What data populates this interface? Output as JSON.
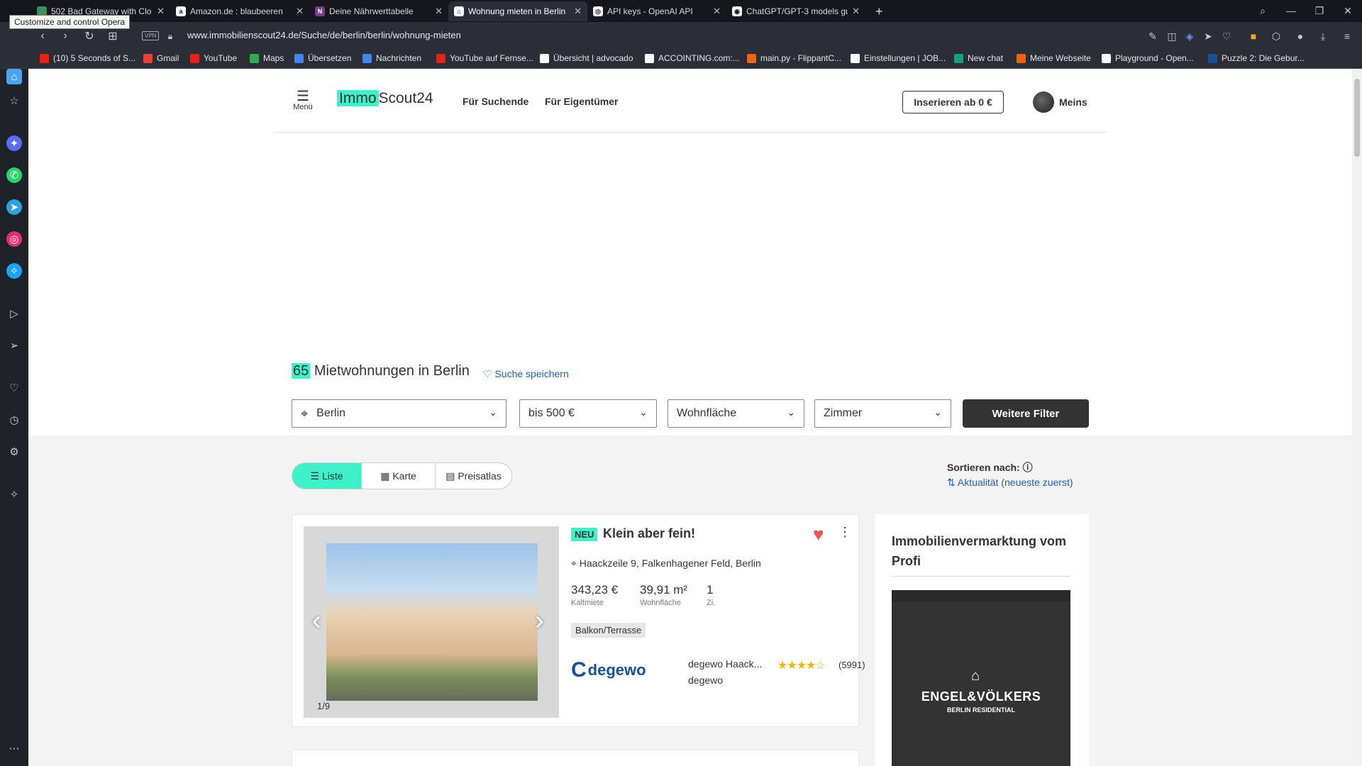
{
  "browser": {
    "tooltip": "Customize and control Opera",
    "tabs": [
      {
        "title": "502 Bad Gateway with Clo",
        "favicon_color": "#3a8f5a"
      },
      {
        "title": "Amazon.de : blaubeeren",
        "favicon_color": "#ffffff"
      },
      {
        "title": "Deine Nährwerttabelle",
        "favicon_color": "#7a3b8f"
      },
      {
        "title": "Wohnung mieten in Berlin",
        "favicon_color": "#ffffff"
      },
      {
        "title": "API keys - OpenAI API",
        "favicon_color": "#ffffff"
      },
      {
        "title": "ChatGPT/GPT-3 models gu",
        "favicon_color": "#ffffff"
      }
    ],
    "close_glyph": "✕",
    "new_tab_glyph": "+",
    "url": "www.immobilienscout24.de/Suche/de/berlin/berlin/wohnung-mieten",
    "vpn_label": "VPN",
    "bookmarks": [
      {
        "label": "(10) 5 Seconds of S...",
        "color": "#e62117"
      },
      {
        "label": "Gmail",
        "color": "#ea4335"
      },
      {
        "label": "YouTube",
        "color": "#e62117"
      },
      {
        "label": "Maps",
        "color": "#34a853"
      },
      {
        "label": "Übersetzen",
        "color": "#4285f4"
      },
      {
        "label": "Nachrichten",
        "color": "#4285f4"
      },
      {
        "label": "YouTube auf Fernse...",
        "color": "#e62117"
      },
      {
        "label": "Übersicht | advocado",
        "color": "#ffffff"
      },
      {
        "label": "ACCOINTING.com:...",
        "color": "#ffffff"
      },
      {
        "label": "main.py - FlippantC...",
        "color": "#f26207"
      },
      {
        "label": "Einstellungen | JOB...",
        "color": "#ffffff"
      },
      {
        "label": "New chat",
        "color": "#10a37f"
      },
      {
        "label": "Meine Webseite",
        "color": "#f26207"
      },
      {
        "label": "Playground - Open...",
        "color": "#ffffff"
      },
      {
        "label": "Puzzle 2: Die Gebur...",
        "color": "#1a4f9c"
      }
    ]
  },
  "header": {
    "menu_label": "Menü",
    "logo_part1": "Immo",
    "logo_part2": "Scout24",
    "nav": [
      "Für Suchende",
      "Für Eigentümer"
    ],
    "insert_button": "Inserieren ab 0 €",
    "account_label": "Meins"
  },
  "results": {
    "count": "65",
    "title": "Mietwohnungen in Berlin",
    "save_search": "Suche speichern"
  },
  "filters": {
    "location": "Berlin",
    "price": "bis 500 €",
    "area": "Wohnfläche",
    "rooms": "Zimmer",
    "more_button": "Weitere Filter"
  },
  "view_toggle": [
    "Liste",
    "Karte",
    "Preisatlas"
  ],
  "sort": {
    "label": "Sortieren nach:",
    "value": "Aktualität (neueste zuerst)"
  },
  "listing": {
    "badge": "NEU",
    "title": "Klein aber fein!",
    "address": "Haackzeile 9, Falkenhagener Feld, Berlin",
    "price_value": "343,23 €",
    "price_label": "Kaltmiete",
    "area_value": "39,91 m²",
    "area_label": "Wohnfläche",
    "rooms_value": "1",
    "rooms_label": "Zi.",
    "tag": "Balkon/Terrasse",
    "photo_counter": "1/9",
    "provider_logo": "degewo",
    "provider_name": "degewo Haack...",
    "provider_company": "degewo",
    "rating_stars": "★★★★☆",
    "rating": 4,
    "reviews": "(5991)"
  },
  "ad": {
    "title": "Immobilienvermarktung vom Profi",
    "brand": "ENGEL&VÖLKERS",
    "brand_sub": "BERLIN RESIDENTIAL"
  }
}
